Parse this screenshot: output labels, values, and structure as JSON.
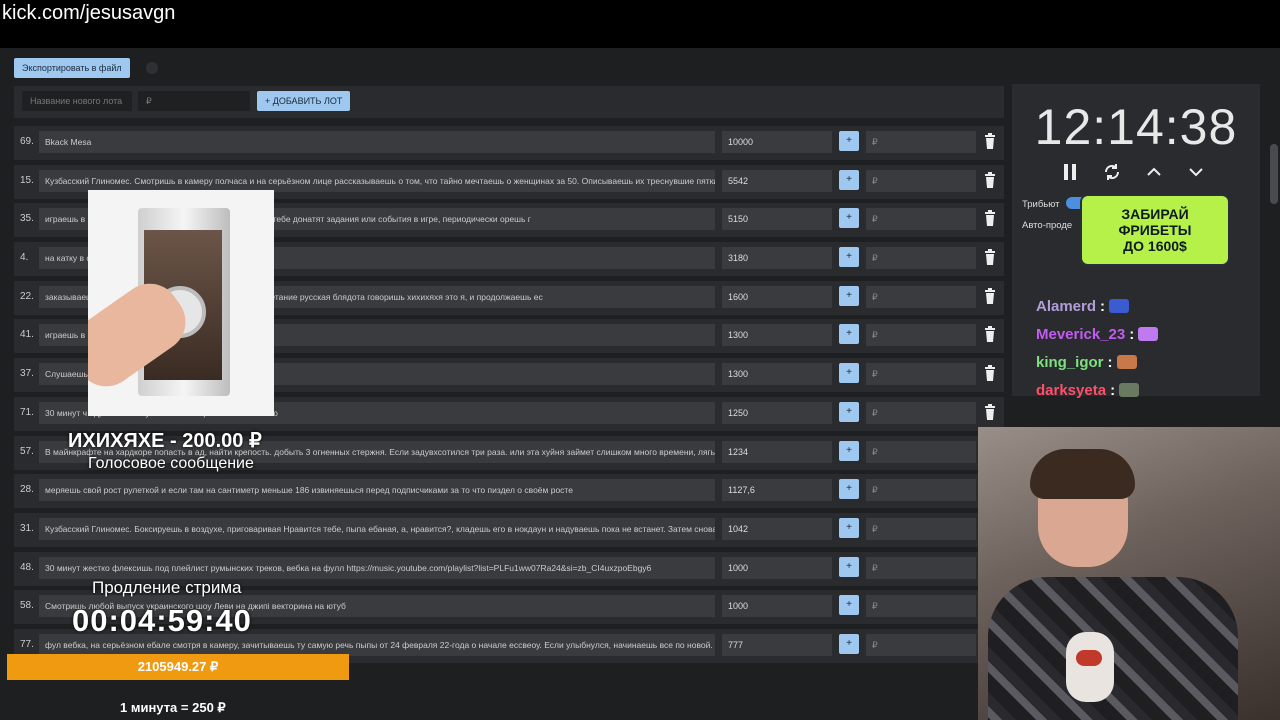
{
  "url_overlay": "kick.com/jesusavgn",
  "toolbar": {
    "export_label": "Экспортировать в файл"
  },
  "add_lot": {
    "name_placeholder": "Название нового лота",
    "amount_placeholder": "₽",
    "add_label": "+ ДОБАВИТЬ ЛОТ"
  },
  "lots": [
    {
      "num": "69.",
      "name": "Bkack Mesa",
      "amount": "10000"
    },
    {
      "num": "15.",
      "name": "Кузбасский Глиномес. Смотришь в камеру полчаса и на серьёзном лице рассказываешь о том, что тайно мечтаешь о женщинах за 50. Описываешь их треснувшие пятки и",
      "amount": "5542"
    },
    {
      "num": "35.",
      "name": "играешь в                                                          будто он твой компаньон читаешь донаты там тебе донатят задания или события в игре, периодически орешь г",
      "amount": "5150"
    },
    {
      "num": "4.",
      "name": "на катку в ср                                                          выгорит",
      "amount": "3180"
    },
    {
      "num": "22.",
      "name": "заказываеш                                                          ет видео шпака, и если он говорит словосочетание русская блядота говоришь хихихяхя это я, и продолжаешь ес",
      "amount": "1600"
    },
    {
      "num": "41.",
      "name": "играешь в                                                          что все читеры и что у тебя лагало",
      "amount": "1300"
    },
    {
      "num": "37.",
      "name": "Слушаешь                                                          , используешь текст гимна",
      "amount": "1300"
    },
    {
      "num": "71.",
      "name": "30 минут ч                                                          ндрю Таненбаума 3 глава Управление памятью",
      "amount": "1250"
    },
    {
      "num": "57.",
      "name": "В майнкрафте на хардкоре попасть в ад, найти крепость. добыть 3 огненных стержня. Если задувхсотился три раза. или эта хуйня займет слишком много времени, лягь н",
      "amount": "1234"
    },
    {
      "num": "28.",
      "name": "меряешь свой рост рулеткой и если там на сантиметр меньше 186 извиняешься перед подписчиками за то что пиздел о своём росте",
      "amount": "1127,6"
    },
    {
      "num": "31.",
      "name": "Кузбасский Глиномес. Боксируешь в воздухе, приговаривая Нравится тебе, пыпа ебаная, а, нравится?, кладешь его в нокдаун и надуваешь пока не встанет. Затем снова х",
      "amount": "1042"
    },
    {
      "num": "48.",
      "name": "30 минут жестко флексишь под плейлист румынских треков, вебка на фулл https://music.youtube.com/playlist?list=PLFu1ww07Ra24&si=zb_CI4uxzpoEbgy6",
      "amount": "1000"
    },
    {
      "num": "58.",
      "name": "Смотришь любой выпуск украинского шоу Леви на джипі векторина на ютуб",
      "amount": "1000"
    },
    {
      "num": "77.",
      "name": "фул вебка, на серьёзном ебале смотря в камеру, зачитываешь ту самую речь пыпы от 24 февраля 22-года о начале ессвеоу. Если улыбнулся, начинаешь все по новой.",
      "amount": "777"
    }
  ],
  "row_plus": "+",
  "row_currency": "₽",
  "timer": {
    "clock": "12:14:38",
    "tribute_label": "Трибьют",
    "auto_label": "Авто-проде"
  },
  "promo": {
    "line1": "ЗАБИРАЙ",
    "line2": "ФРИБЕТЫ",
    "line3": "ДО 1600$"
  },
  "chat": [
    {
      "user": "Alamerd",
      "color": "#b39ddb",
      "emote": "#3b5bd0"
    },
    {
      "user": "Meverick_23",
      "color": "#c25cf0",
      "emote": "#c07af0"
    },
    {
      "user": "king_igor",
      "color": "#7ee07e",
      "emote": "#c9784a"
    },
    {
      "user": "darksyeta",
      "color": "#ff4f6b",
      "emote": "#6a7a60"
    }
  ],
  "chat_separator": ":",
  "alert": {
    "title": "ИХИХЯХЕ - 200.00 ₽",
    "subtitle": "Голосовое сообщение"
  },
  "extension": {
    "title": "Продление стрима",
    "time": "00:04:59:40"
  },
  "total": {
    "amount": "2105949.27 ₽",
    "progress": 1.0
  },
  "rate": "1 минута = 250 ₽",
  "colors": {
    "accent": "#9fc8f0",
    "progress": "#f0920a",
    "promo": "#b6f14a",
    "panel": "#2a2b2e"
  }
}
